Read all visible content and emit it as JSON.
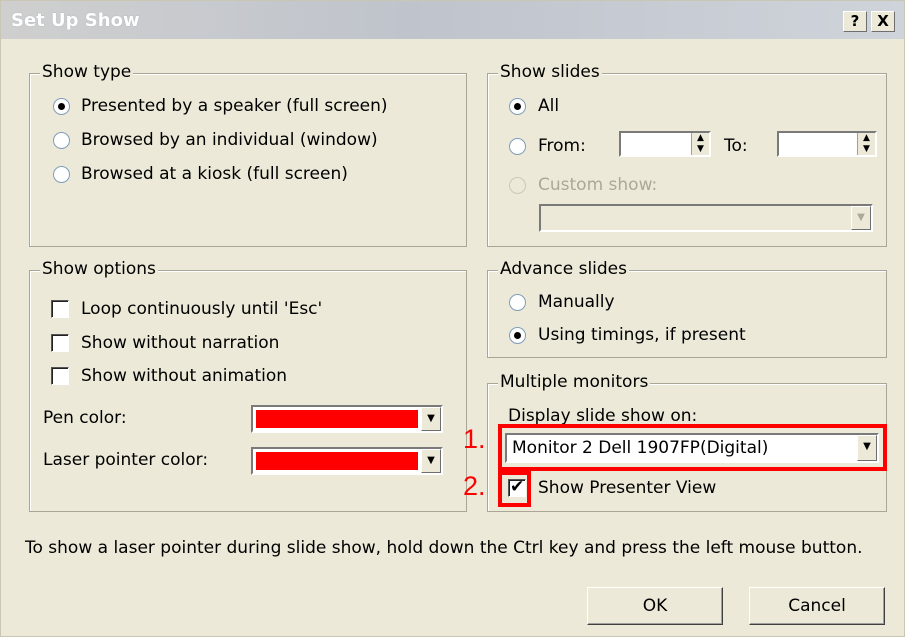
{
  "dialog": {
    "title": "Set Up Show",
    "help_button": "?",
    "close_button": "X"
  },
  "show_type": {
    "legend": "Show type",
    "options": [
      {
        "label": "Presented by a speaker (full screen)",
        "selected": true
      },
      {
        "label": "Browsed by an individual (window)",
        "selected": false
      },
      {
        "label": "Browsed at a kiosk (full screen)",
        "selected": false
      }
    ]
  },
  "show_slides": {
    "legend": "Show slides",
    "all_label": "All",
    "from_label": "From:",
    "from_value": "",
    "to_label": "To:",
    "to_value": "",
    "custom_label": "Custom show:",
    "custom_value": "",
    "selected": "All"
  },
  "show_options": {
    "legend": "Show options",
    "checkboxes": [
      {
        "label": "Loop continuously until 'Esc'",
        "checked": false
      },
      {
        "label": "Show without narration",
        "checked": false
      },
      {
        "label": "Show without animation",
        "checked": false
      }
    ],
    "pen_color_label": "Pen color:",
    "pen_color": "#ff0000",
    "laser_color_label": "Laser pointer color:",
    "laser_color": "#ff0000"
  },
  "advance_slides": {
    "legend": "Advance slides",
    "options": [
      {
        "label": "Manually",
        "selected": false
      },
      {
        "label": "Using timings, if present",
        "selected": true
      }
    ]
  },
  "multiple_monitors": {
    "legend": "Multiple monitors",
    "display_label": "Display slide show on:",
    "display_value": "Monitor 2 Dell 1907FP(Digital)",
    "presenter_view_label": "Show Presenter View",
    "presenter_view_checked": true
  },
  "annotations": {
    "marker_1": "1.",
    "marker_2": "2.",
    "color": "#ff0000"
  },
  "footer": {
    "hint": "To show a laser pointer during slide show, hold down the Ctrl key and press the left mouse button.",
    "ok_label": "OK",
    "cancel_label": "Cancel"
  }
}
